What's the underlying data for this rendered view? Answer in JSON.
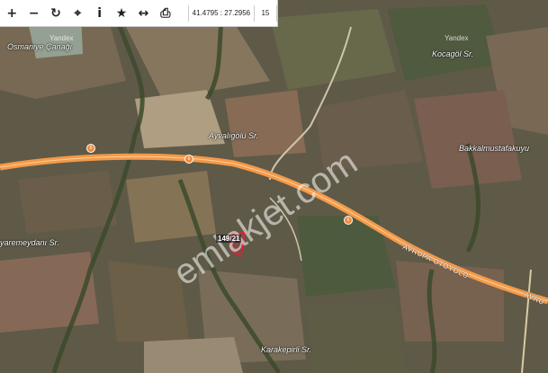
{
  "toolbar": {
    "tools": [
      {
        "name": "zoom-in-icon",
        "glyph": "+"
      },
      {
        "name": "zoom-out-icon",
        "glyph": "−"
      },
      {
        "name": "refresh-icon",
        "glyph": "↻"
      },
      {
        "name": "locate-icon",
        "glyph": "⌖"
      },
      {
        "name": "info-icon",
        "glyph": "i"
      },
      {
        "name": "star-icon",
        "glyph": "★"
      },
      {
        "name": "measure-icon",
        "glyph": "↔"
      },
      {
        "name": "print-icon",
        "glyph": "⎙"
      }
    ],
    "coordinates": "41.4795 : 27.2956",
    "zoom_level": "15"
  },
  "map": {
    "places": {
      "osmaniye": "Osmaniye Çanağı",
      "kocagol": "Kocagöl Sr.",
      "ayvaligolu": "Ayvalıgölü Sr.",
      "bakkal": "Bakkalmustafakuyu",
      "yaremeydani": "yaremeydanı Sr.",
      "karakepirli": "Karakepirli Sr."
    },
    "highway": {
      "name": "AVRUPA OTOYOLU",
      "name_cut": "AVRU",
      "shield": "6"
    },
    "parcel_label": "149/21",
    "provider": "Yandex",
    "watermark": "emlakjet.com",
    "colors": {
      "highway": "#f39a4a",
      "parcel": "#e0203a",
      "field_dark": "#4a4a3a"
    }
  }
}
